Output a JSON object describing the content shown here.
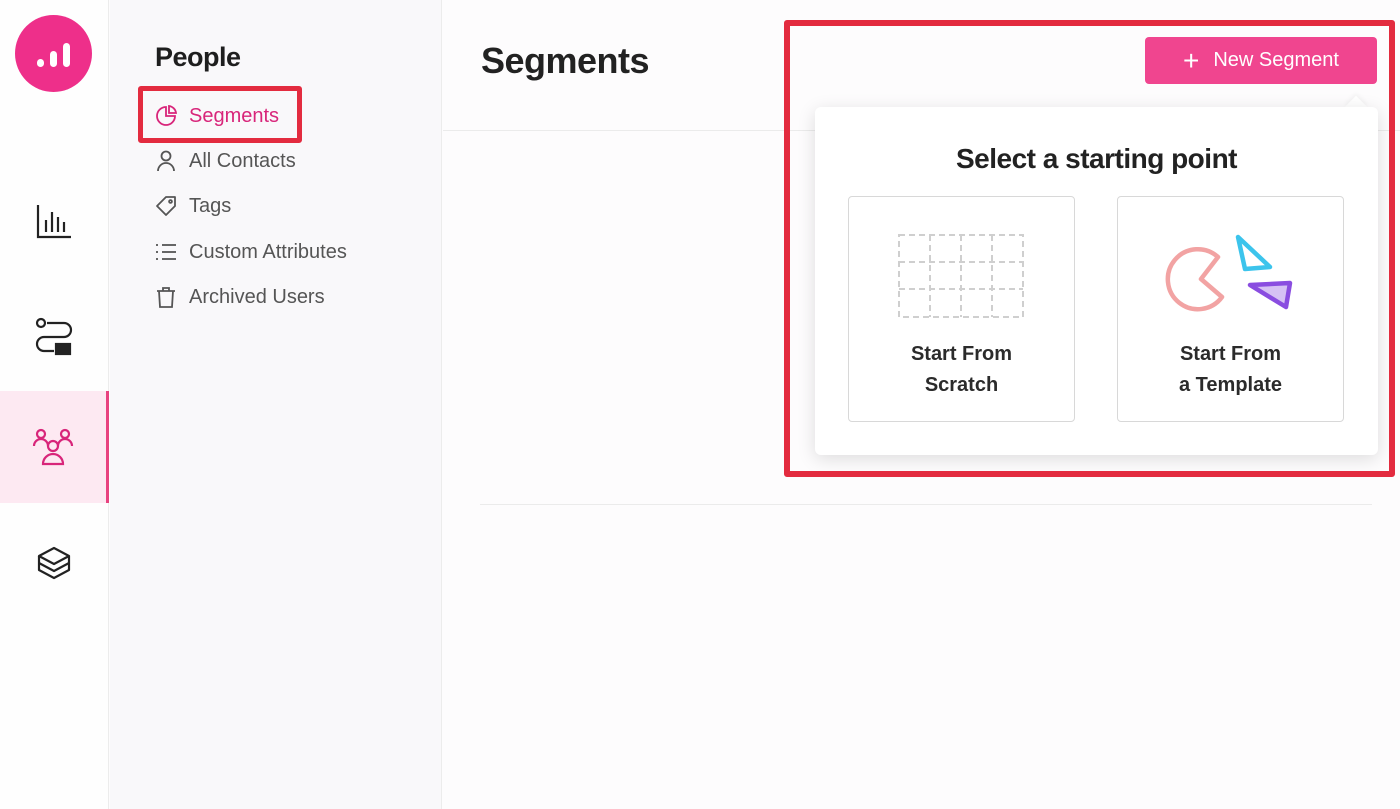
{
  "rail": {
    "items": [
      {
        "name": "analytics",
        "icon": "bar-chart-icon"
      },
      {
        "name": "workflows",
        "icon": "workflow-icon"
      },
      {
        "name": "people",
        "icon": "people-icon",
        "active": true
      },
      {
        "name": "products",
        "icon": "box-icon"
      }
    ]
  },
  "sidebar": {
    "title": "People",
    "items": [
      {
        "label": "Segments",
        "icon": "pie-chart-icon",
        "active": true
      },
      {
        "label": "All Contacts",
        "icon": "user-icon"
      },
      {
        "label": "Tags",
        "icon": "tag-icon"
      },
      {
        "label": "Custom Attributes",
        "icon": "list-icon"
      },
      {
        "label": "Archived Users",
        "icon": "trash-icon"
      }
    ]
  },
  "main": {
    "title": "Segments",
    "new_button": {
      "plus": "+",
      "label": "New Segment"
    }
  },
  "popover": {
    "title": "Select a starting point",
    "options": [
      {
        "line1": "Start From",
        "line2": "Scratch",
        "icon": "empty-grid-icon"
      },
      {
        "line1": "Start From",
        "line2": "a Template",
        "icon": "template-shapes-icon"
      }
    ]
  },
  "colors": {
    "brand": "#ee2f8a",
    "button": "#f0458f",
    "active_text": "#d8257a",
    "highlight": "#e32b3f"
  }
}
